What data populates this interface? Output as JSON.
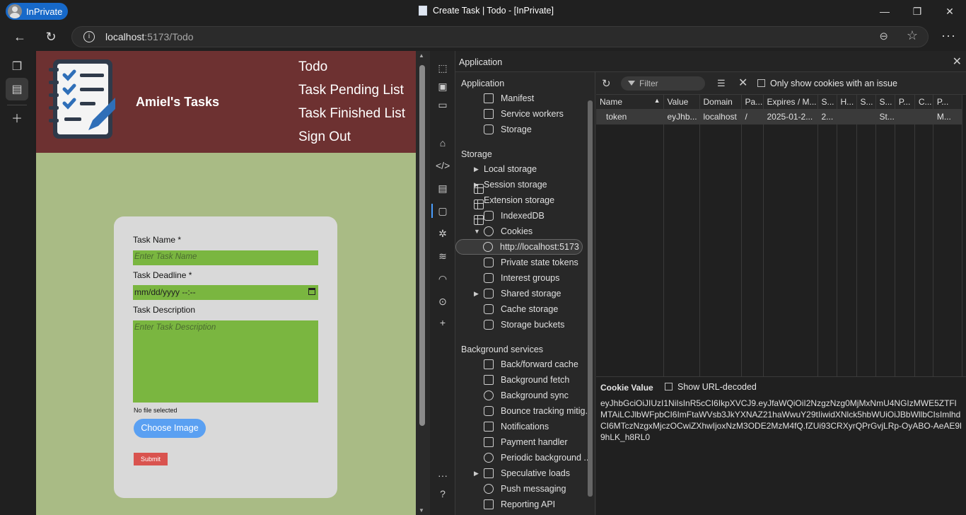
{
  "browser": {
    "inprivate_label": "InPrivate",
    "window_title": "Create Task | Todo - [InPrivate]",
    "url_host": "localhost",
    "url_rest": ":5173/Todo"
  },
  "site": {
    "brand": "Amiel's Tasks",
    "nav": [
      "Todo",
      "Task Pending List",
      "Task Finished List",
      "Sign Out"
    ]
  },
  "form": {
    "task_name_label": "Task Name *",
    "task_name_placeholder": "Enter Task Name",
    "deadline_label": "Task Deadline *",
    "deadline_value": "mm/dd/yyyy --:--",
    "desc_label": "Task Description",
    "desc_placeholder": "Enter Task Description",
    "file_status": "No file selected",
    "choose_image": "Choose Image",
    "submit": "Submit"
  },
  "devtools": {
    "panel_title": "Application",
    "sections": {
      "application": "Application",
      "storage": "Storage",
      "background": "Background services"
    },
    "application_items": [
      "Manifest",
      "Service workers",
      "Storage"
    ],
    "storage_items": [
      "Local storage",
      "Session storage",
      "Extension storage",
      "IndexedDB",
      "Cookies",
      "http://localhost:5173",
      "Private state tokens",
      "Interest groups",
      "Shared storage",
      "Cache storage",
      "Storage buckets"
    ],
    "background_items": [
      "Back/forward cache",
      "Background fetch",
      "Background sync",
      "Bounce tracking mitig...",
      "Notifications",
      "Payment handler",
      "Periodic background ...",
      "Speculative loads",
      "Push messaging",
      "Reporting API"
    ],
    "filter_placeholder": "Filter",
    "only_issue_label": "Only show cookies with an issue",
    "columns": [
      "Name",
      "Value",
      "Domain",
      "Pa...",
      "Expires / M...",
      "S...",
      "H...",
      "S...",
      "S...",
      "P...",
      "C...",
      "P..."
    ],
    "row": [
      "token",
      "eyJhb...",
      "localhost",
      "/",
      "2025-01-2...",
      "2...",
      "",
      "",
      "St...",
      "",
      "",
      "M..."
    ],
    "cookie_value_title": "Cookie Value",
    "show_decoded_label": "Show URL-decoded",
    "cookie_value": "eyJhbGciOiJIUzI1NiIsInR5cCI6IkpXVCJ9.eyJfaWQiOiI2NzgzNzg0MjMxNmU4NGIzMWE5ZTFlMTAiLCJlbWFpbCI6ImFtaWVsb3JkYXNAZ21haWwuY29tIiwidXNlck5hbWUiOiJBbWllbCIsImlhdCI6MTczNzgxMjczOCwiZXhwIjoxNzM3ODE2MzM4fQ.fZUi93CRXyrQPrGvjLRp-OyABO-AeAE9l9hLK_h8RL0"
  }
}
